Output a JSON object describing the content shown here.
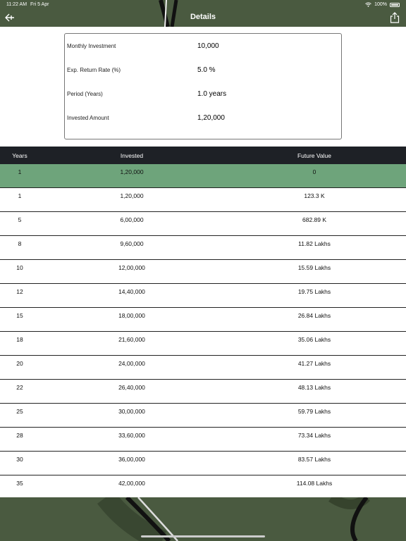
{
  "status": {
    "time": "11:22 AM",
    "date": "Fri 5 Apr",
    "battery": "100%"
  },
  "nav": {
    "title": "Details"
  },
  "details": {
    "monthly_investment_label": "Monthly Investment",
    "monthly_investment_value": "10,000",
    "return_rate_label": "Exp. Return Rate (%)",
    "return_rate_value": "5.0 %",
    "period_label": "Period (Years)",
    "period_value": "1.0 years",
    "invested_amount_label": "Invested Amount",
    "invested_amount_value": "1,20,000"
  },
  "table": {
    "headers": {
      "years": "Years",
      "invested": "Invested",
      "future": "Future Value"
    },
    "rows": [
      {
        "years": "1",
        "invested": "1,20,000",
        "future": "0"
      },
      {
        "years": "1",
        "invested": "1,20,000",
        "future": "123.3 K"
      },
      {
        "years": "5",
        "invested": "6,00,000",
        "future": "682.89 K"
      },
      {
        "years": "8",
        "invested": "9,60,000",
        "future": "11.82 Lakhs"
      },
      {
        "years": "10",
        "invested": "12,00,000",
        "future": "15.59 Lakhs"
      },
      {
        "years": "12",
        "invested": "14,40,000",
        "future": "19.75 Lakhs"
      },
      {
        "years": "15",
        "invested": "18,00,000",
        "future": "26.84 Lakhs"
      },
      {
        "years": "18",
        "invested": "21,60,000",
        "future": "35.06 Lakhs"
      },
      {
        "years": "20",
        "invested": "24,00,000",
        "future": "41.27 Lakhs"
      },
      {
        "years": "22",
        "invested": "26,40,000",
        "future": "48.13 Lakhs"
      },
      {
        "years": "25",
        "invested": "30,00,000",
        "future": "59.79 Lakhs"
      },
      {
        "years": "28",
        "invested": "33,60,000",
        "future": "73.34 Lakhs"
      },
      {
        "years": "30",
        "invested": "36,00,000",
        "future": "83.57 Lakhs"
      },
      {
        "years": "35",
        "invested": "42,00,000",
        "future": "114.08 Lakhs"
      }
    ]
  },
  "colors": {
    "header_bg": "#4a5a40",
    "table_header_bg": "#1e2126",
    "highlight_row": "#6ea47b"
  }
}
